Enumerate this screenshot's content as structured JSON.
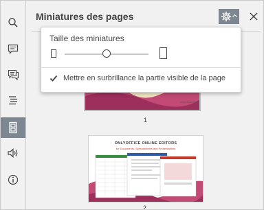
{
  "panel": {
    "title": "Miniatures des pages"
  },
  "sidebar": {
    "items": [
      {
        "name": "search-icon",
        "active": false
      },
      {
        "name": "comments-icon",
        "active": false
      },
      {
        "name": "chat-icon",
        "active": false
      },
      {
        "name": "navigation-icon",
        "active": false
      },
      {
        "name": "page-thumbnails-icon",
        "active": true
      },
      {
        "name": "speaker-icon",
        "active": false
      },
      {
        "name": "info-icon",
        "active": false
      }
    ]
  },
  "popup": {
    "label": "Taille des miniatures",
    "slider_value": 0.5,
    "highlight_label": "Mettre en surbrillance la partie visible de la page",
    "highlight_checked": true
  },
  "thumbnails": {
    "page1_number": "1",
    "page2_number": "2",
    "page2_heading": "ONLYOFFICE ONLINE EDITORS",
    "page2_subheading": "for Documents, Spreadsheets and Presentations"
  },
  "colors": {
    "active_bg": "#7d8791",
    "accent_red": "#c0392b",
    "wave_pink": "#c24a74"
  }
}
